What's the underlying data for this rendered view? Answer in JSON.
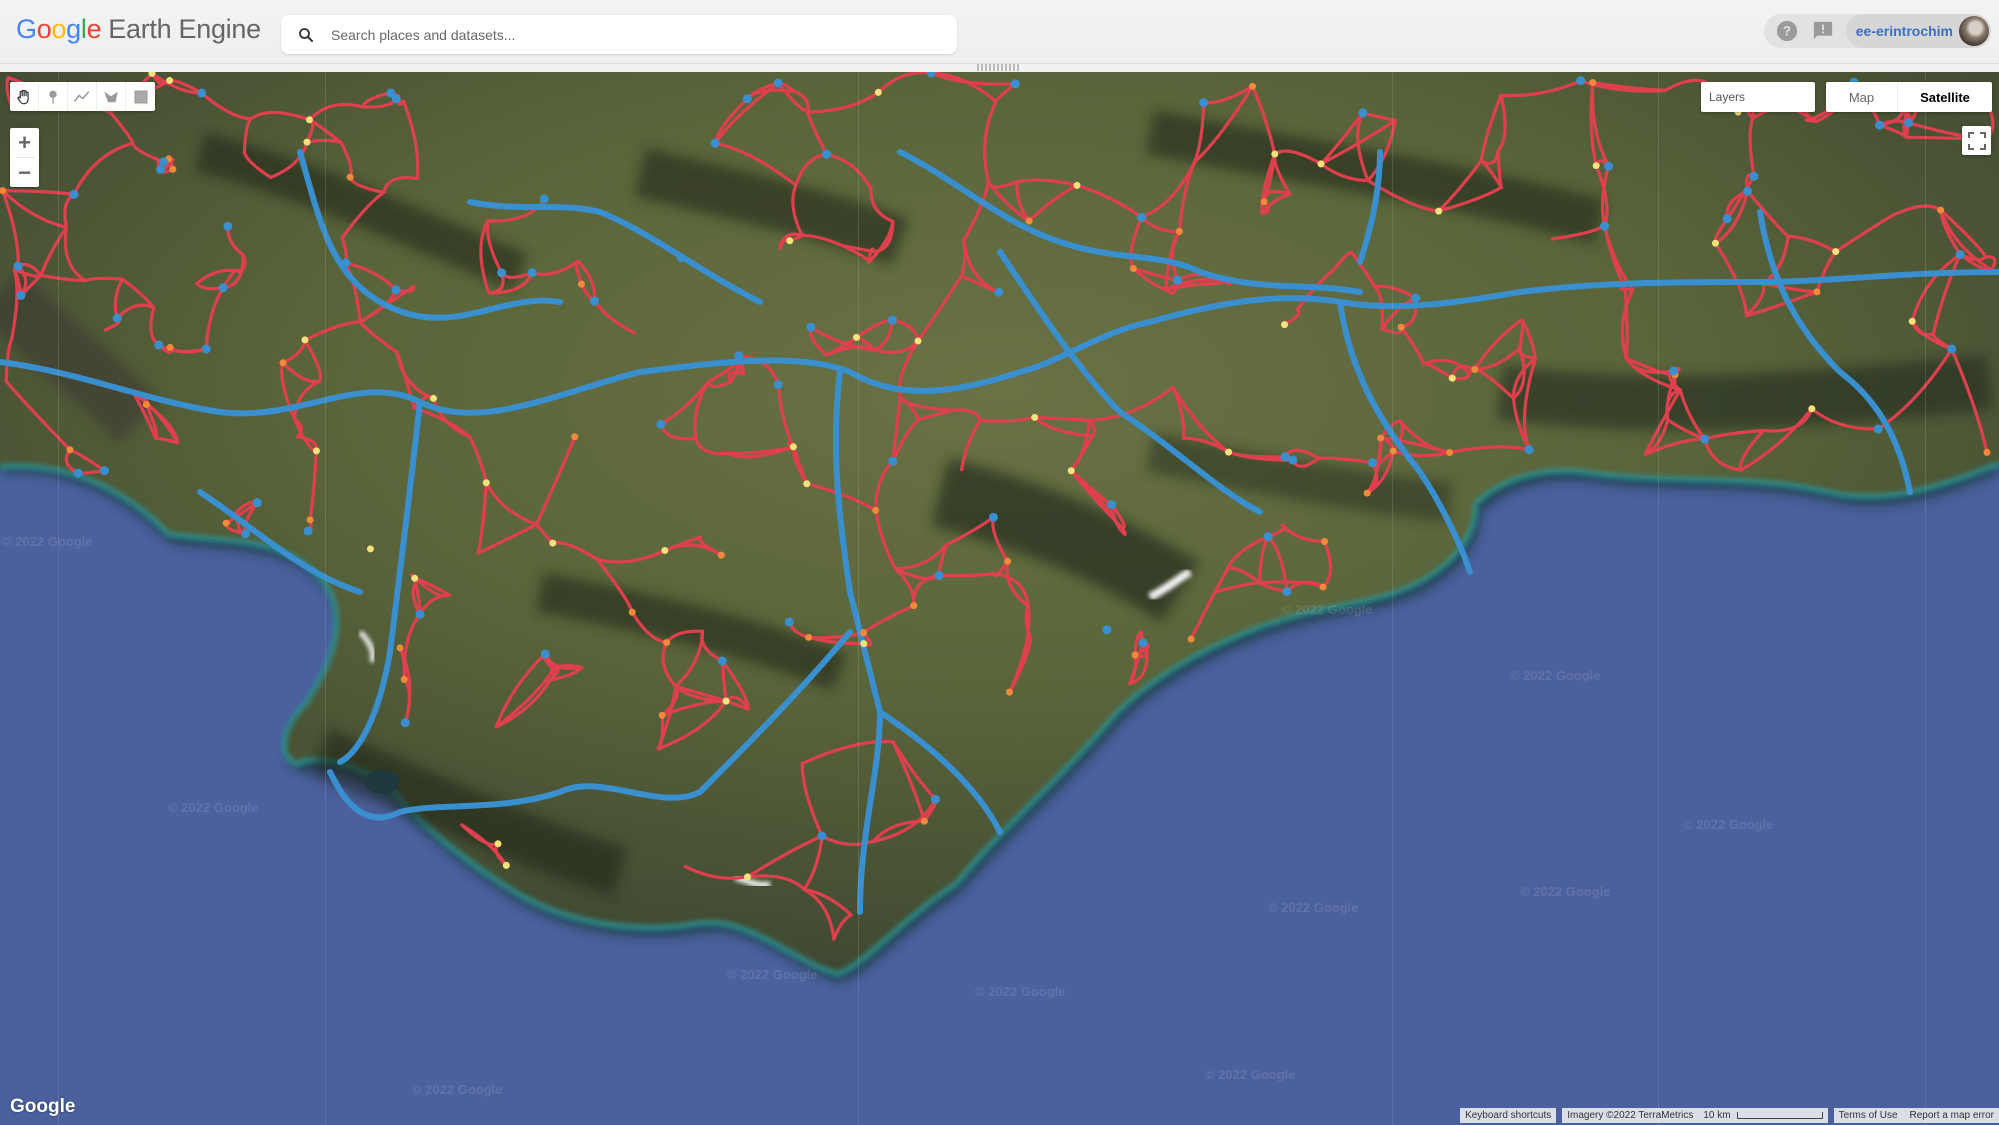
{
  "header": {
    "logo_google_letters": [
      "G",
      "o",
      "o",
      "g",
      "l",
      "e"
    ],
    "logo_google_colors": [
      "#4285F4",
      "#EA4335",
      "#FBBC05",
      "#4285F4",
      "#34A853",
      "#EA4335"
    ],
    "logo_product": "Earth Engine",
    "search": {
      "placeholder": "Search places and datasets...",
      "value": ""
    },
    "help_icon": "help-icon",
    "feedback_icon": "feedback-icon",
    "user": {
      "name": "ee-erintrochim"
    }
  },
  "map": {
    "drawing_tools": [
      {
        "name": "pan-hand-icon",
        "title": "Stop drawing"
      },
      {
        "name": "marker-icon",
        "title": "Add a marker"
      },
      {
        "name": "line-icon",
        "title": "Draw a line"
      },
      {
        "name": "polygon-icon",
        "title": "Draw a shape"
      },
      {
        "name": "rectangle-icon",
        "title": "Draw a rectangle"
      }
    ],
    "zoom_in_label": "+",
    "zoom_out_label": "−",
    "layers_label": "Layers",
    "map_types": [
      {
        "label": "Map",
        "selected": false
      },
      {
        "label": "Satellite",
        "selected": true
      }
    ],
    "watermark_text": "© 2022 Google",
    "google_logo": "Google",
    "attribution": {
      "keyboard_shortcuts": "Keyboard shortcuts",
      "imagery": "Imagery ©2022 TerraMetrics",
      "scale_label": "10 km",
      "terms": "Terms of Use",
      "report": "Report a map error"
    },
    "colors": {
      "ocean": "#4a5f9c",
      "land_green": "#5a6b3a",
      "land_dark": "#2f3a26",
      "road_red": "#e0404e",
      "road_blue": "#3a8fcf",
      "road_yellow": "#f5e27a",
      "road_orange": "#f28a3a"
    }
  }
}
